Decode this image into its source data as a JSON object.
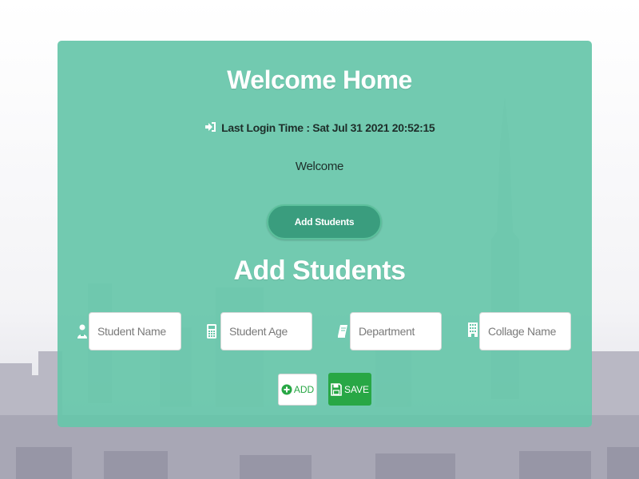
{
  "header": {
    "title": "Welcome Home",
    "last_login": "Last Login Time : Sat Jul 31 2021 20:52:15",
    "welcome": "Welcome"
  },
  "actions": {
    "add_students_label": "Add Students"
  },
  "form": {
    "title": "Add Students",
    "fields": [
      {
        "placeholder": "Student Name",
        "icon": "user-icon"
      },
      {
        "placeholder": "Student Age",
        "icon": "calculator-icon"
      },
      {
        "placeholder": "Department",
        "icon": "book-icon"
      },
      {
        "placeholder": "Collage Name",
        "icon": "building-icon"
      }
    ],
    "add_label": "ADD",
    "save_label": "SAVE"
  },
  "colors": {
    "panel": "#67c6aa",
    "primary_button": "#3a9d7e",
    "success": "#28a745"
  }
}
